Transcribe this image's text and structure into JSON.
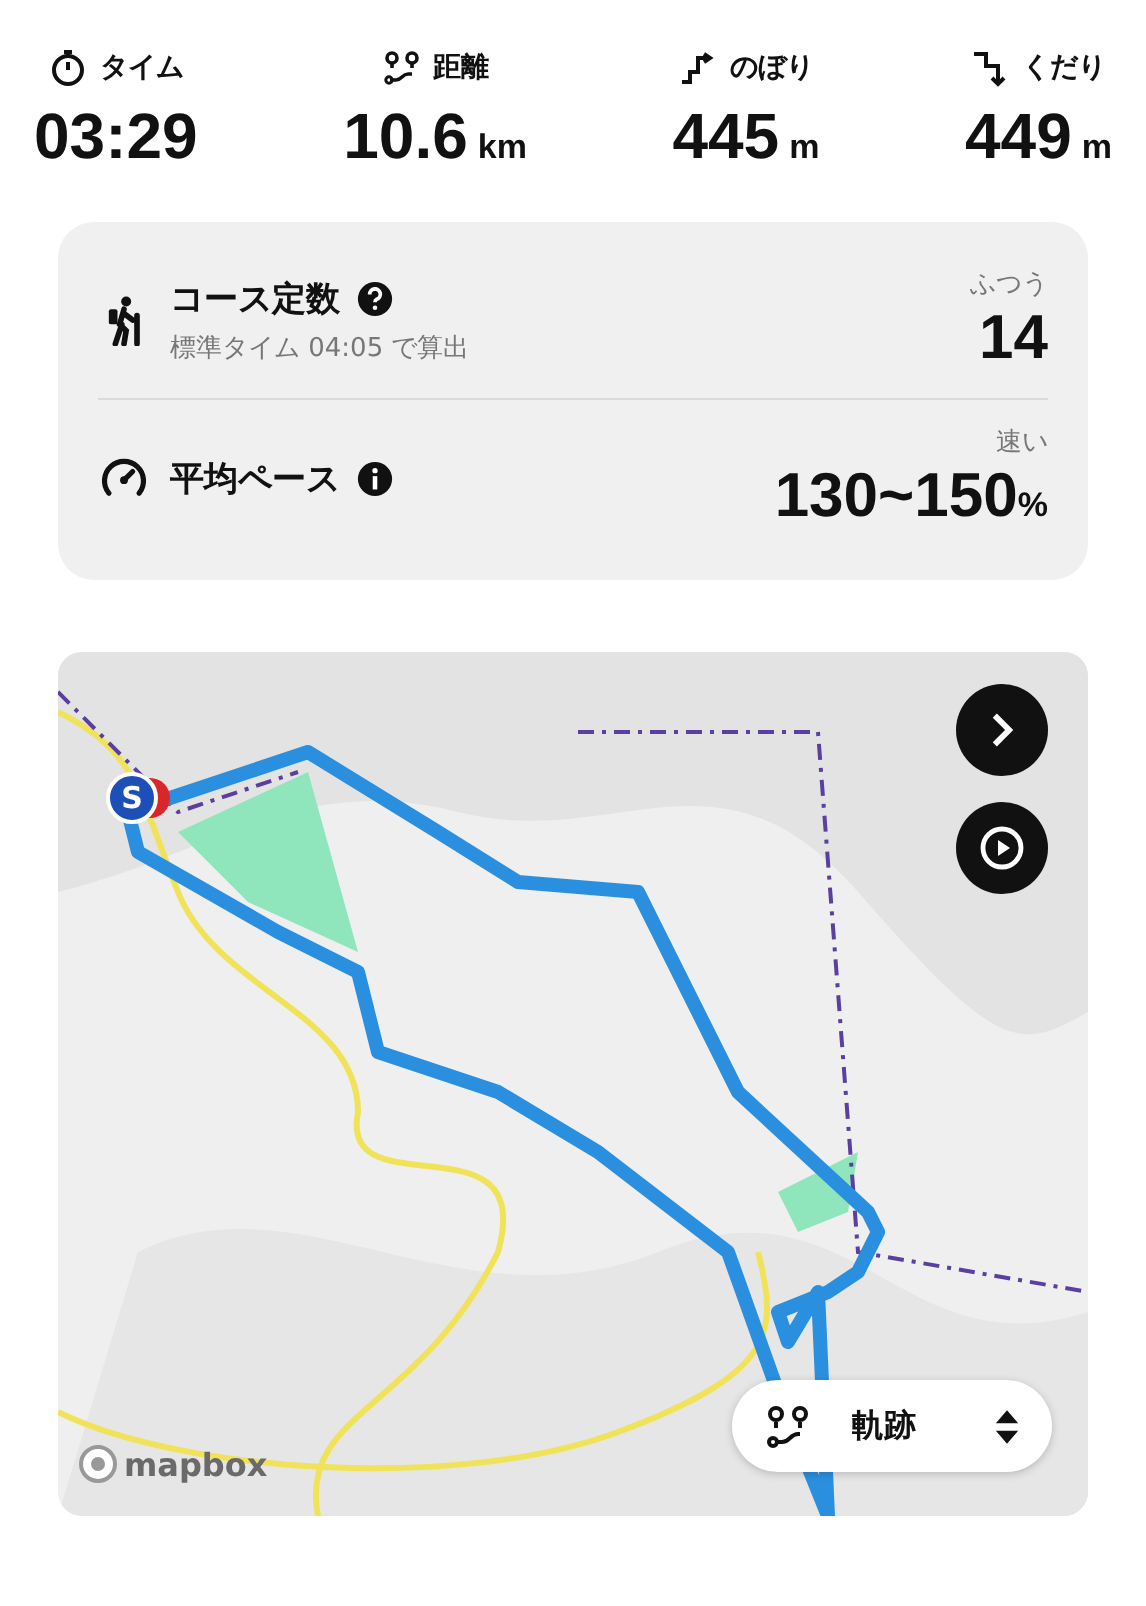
{
  "stats": [
    {
      "kind": "time",
      "label": "タイム",
      "value": "03:29"
    },
    {
      "kind": "distance",
      "label": "距離",
      "value": "10.6",
      "unit": "km"
    },
    {
      "kind": "ascent",
      "label": "のぼり",
      "value": "445",
      "unit": "m"
    },
    {
      "kind": "descent",
      "label": "くだり",
      "value": "449",
      "unit": "m"
    }
  ],
  "summary": [
    {
      "kind": "course",
      "title": "コース定数",
      "subtitle": "標準タイム 04:05 で算出",
      "rating": "ふつう",
      "value": "14"
    },
    {
      "kind": "pace",
      "title": "平均ペース",
      "rating": "速い",
      "value": "130~150",
      "unit": "%"
    }
  ],
  "map": {
    "kind": "picture",
    "start_marker": "S",
    "attribution": "mapbox",
    "track_selector": {
      "label": "軌跡"
    }
  }
}
